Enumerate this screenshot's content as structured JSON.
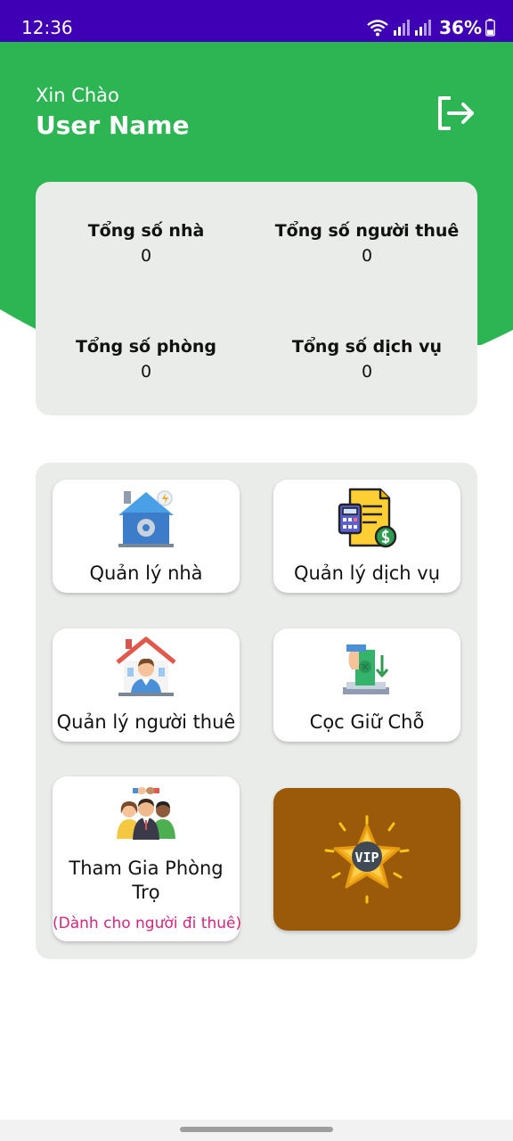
{
  "status_bar": {
    "time": "12:36",
    "battery": "36%"
  },
  "header": {
    "greeting": "Xin Chào",
    "username": "User Name",
    "logout_icon": "logout-icon"
  },
  "stats": [
    {
      "label": "Tổng số nhà",
      "value": "0"
    },
    {
      "label": "Tổng số người thuê",
      "value": "0"
    },
    {
      "label": "Tổng số phòng",
      "value": "0"
    },
    {
      "label": "Tổng số dịch vụ",
      "value": "0"
    }
  ],
  "menu": {
    "items": [
      {
        "label": "Quản lý nhà",
        "icon": "smart-house-icon"
      },
      {
        "label": "Quản lý dịch vụ",
        "icon": "invoice-calculator-icon"
      },
      {
        "label": "Quản lý người thuê",
        "icon": "tenant-house-icon"
      },
      {
        "label": "Cọc Giữ Chỗ",
        "icon": "deposit-money-icon"
      },
      {
        "label_line1": "Tham Gia Phòng",
        "label_line2": "Trọ",
        "sublabel": "(Dành cho người đi thuê)",
        "icon": "group-people-icon"
      }
    ],
    "vip": {
      "label": "VIP",
      "icon": "vip-star-icon"
    }
  },
  "colors": {
    "status_bar": "#3f00b5",
    "brand_green": "#2db553",
    "vip_brown": "#9b5a0a",
    "panel_gray": "#e9ece9",
    "accent_pink": "#d9247c"
  }
}
